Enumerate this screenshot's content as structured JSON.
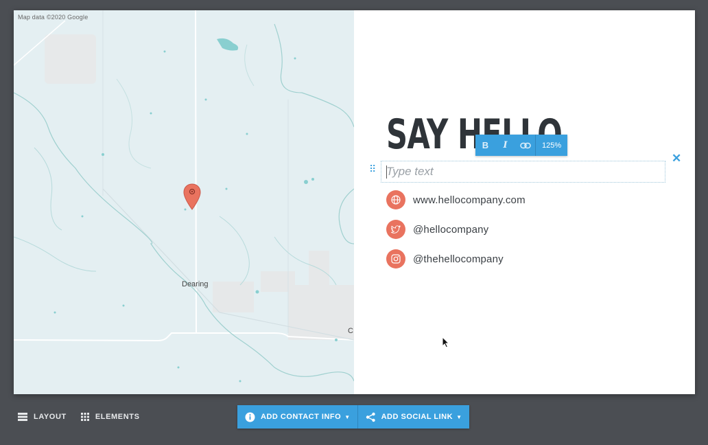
{
  "map": {
    "attribution": "Map data ©2020 Google",
    "town_label": "Dearing",
    "edge_label": "C"
  },
  "content": {
    "heading": "SAY HELLO",
    "toolbar": {
      "bold_label": "B",
      "italic_label": "I",
      "zoom_label": "125%"
    },
    "text_field_placeholder": "Type text",
    "contacts": [
      {
        "icon": "globe-icon",
        "text": "www.hellocompany.com"
      },
      {
        "icon": "twitter-icon",
        "text": "@hellocompany"
      },
      {
        "icon": "instagram-icon",
        "text": "@thehellocompany"
      }
    ]
  },
  "bottom_bar": {
    "layout_label": "LAYOUT",
    "elements_label": "ELEMENTS",
    "add_contact_label": "ADD CONTACT INFO",
    "add_social_label": "ADD SOCIAL LINK"
  },
  "colors": {
    "accent_blue": "#3aa0de",
    "contact_icon": "#e9735f",
    "map_background": "#e4eff2",
    "heading": "#2f3439",
    "page_background": "#4b4e53"
  }
}
